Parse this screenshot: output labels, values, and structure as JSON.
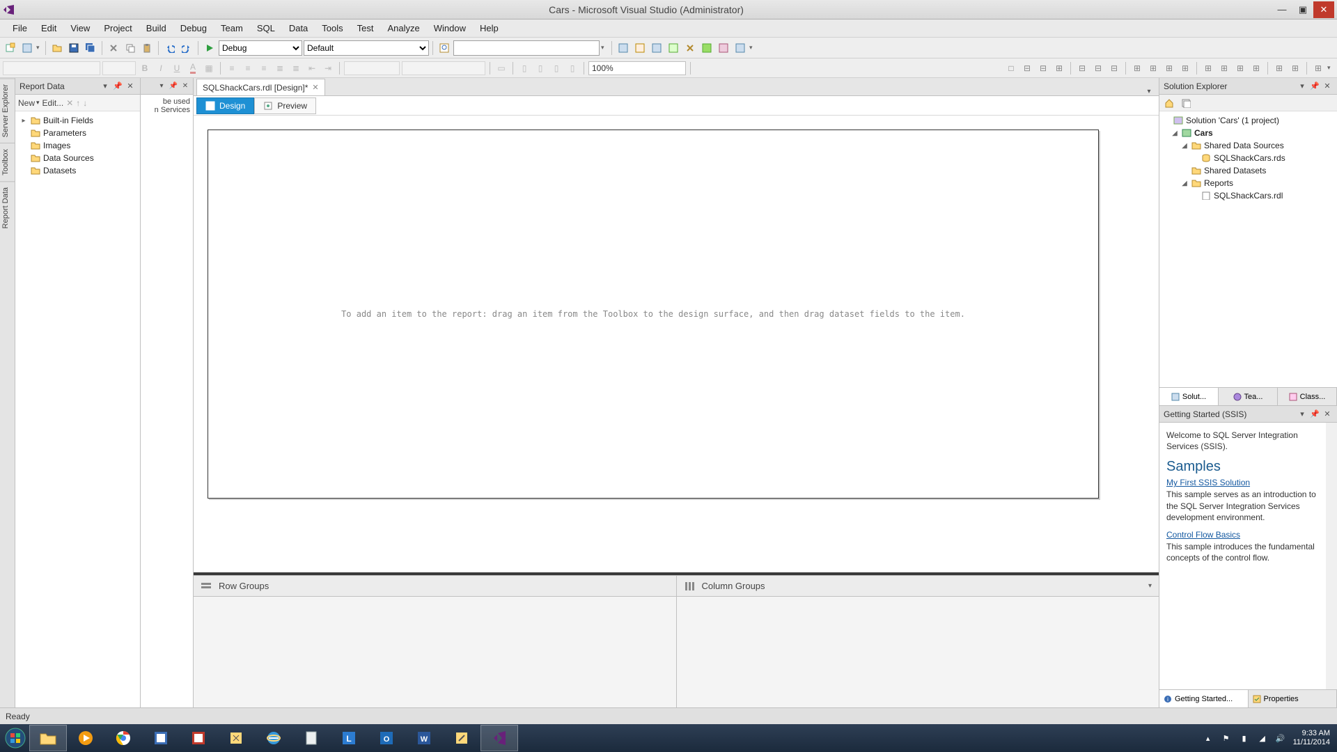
{
  "titlebar": {
    "title": "Cars - Microsoft Visual Studio (Administrator)"
  },
  "menu": [
    "File",
    "Edit",
    "View",
    "Project",
    "Build",
    "Debug",
    "Team",
    "SQL",
    "Data",
    "Tools",
    "Test",
    "Analyze",
    "Window",
    "Help"
  ],
  "toolbar": {
    "config": "Debug",
    "platform": "Default",
    "zoom": "100%"
  },
  "reportData": {
    "title": "Report Data",
    "newLabel": "New",
    "editLabel": "Edit...",
    "nodes": [
      "Built-in Fields",
      "Parameters",
      "Images",
      "Data Sources",
      "Datasets"
    ]
  },
  "peek": {
    "line1": "be used",
    "line2": "n Services"
  },
  "document": {
    "tab": "SQLShackCars.rdl [Design]*"
  },
  "designTabs": {
    "design": "Design",
    "preview": "Preview"
  },
  "canvas": {
    "hint": "To add an item to the report: drag an item from the Toolbox to the design surface, and then drag dataset fields to the item."
  },
  "groups": {
    "row": "Row Groups",
    "column": "Column Groups"
  },
  "solution": {
    "title": "Solution Explorer",
    "root": "Solution 'Cars' (1 project)",
    "project": "Cars",
    "sds": "Shared Data Sources",
    "sdsItem": "SQLShackCars.rds",
    "sdsets": "Shared Datasets",
    "reports": "Reports",
    "reportItem": "SQLShackCars.rdl",
    "tabs": {
      "solution": "Solut...",
      "team": "Tea...",
      "class": "Class..."
    }
  },
  "getting": {
    "title": "Getting Started (SSIS)",
    "welcome": "Welcome to SQL Server Integration Services (SSIS).",
    "samplesHeader": "Samples",
    "link1": "My First SSIS Solution",
    "desc1": "This sample serves as an introduction to the SQL Server Integration Services development environment.",
    "link2": "Control Flow Basics",
    "desc2": "This sample introduces the fundamental concepts of the control flow.",
    "tabs": {
      "getting": "Getting Started...",
      "properties": "Properties"
    }
  },
  "sideTabs": [
    "Server Explorer",
    "Toolbox",
    "Report Data"
  ],
  "status": {
    "ready": "Ready"
  },
  "taskbar": {
    "time": "9:33 AM",
    "date": "11/11/2014"
  }
}
